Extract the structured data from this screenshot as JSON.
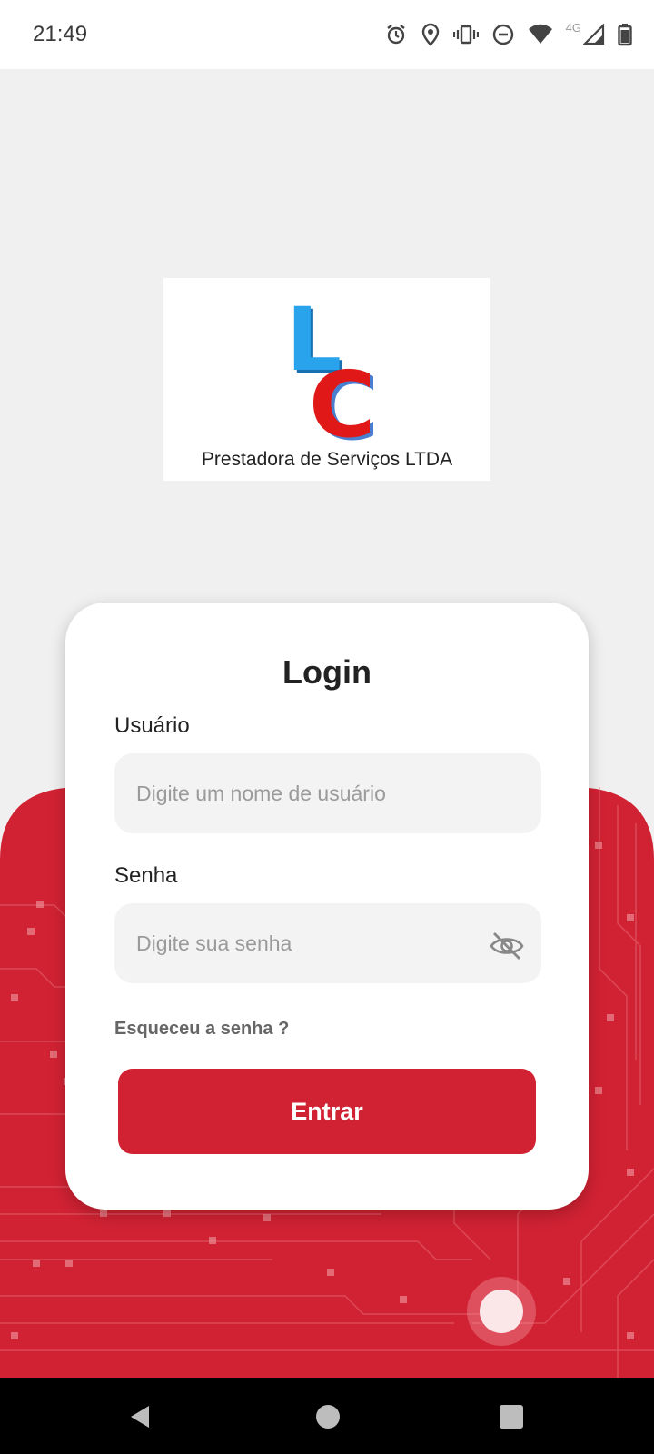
{
  "status_bar": {
    "time": "21:49",
    "network_label": "4G",
    "icons": [
      "alarm-icon",
      "location-icon",
      "vibrate-icon",
      "dnd-icon",
      "wifi-icon",
      "signal-icon",
      "battery-icon"
    ]
  },
  "logo": {
    "letter_1": "L",
    "letter_2": "C",
    "caption": "Prestadora de Serviços LTDA",
    "colors": {
      "l": "#29a3ec",
      "c": "#e01818"
    }
  },
  "login": {
    "title": "Login",
    "username_label": "Usuário",
    "username_placeholder": "Digite um nome de usuário",
    "username_value": "",
    "password_label": "Senha",
    "password_placeholder": "Digite sua senha",
    "password_value": "",
    "forgot_link": "Esqueceu a senha ?",
    "submit_label": "Entrar"
  },
  "colors": {
    "accent": "#d12233",
    "page_background": "#f0f0f0",
    "card_background": "#ffffff"
  },
  "nav_bar": {
    "icons": [
      "back-icon",
      "home-icon",
      "recents-icon"
    ]
  }
}
